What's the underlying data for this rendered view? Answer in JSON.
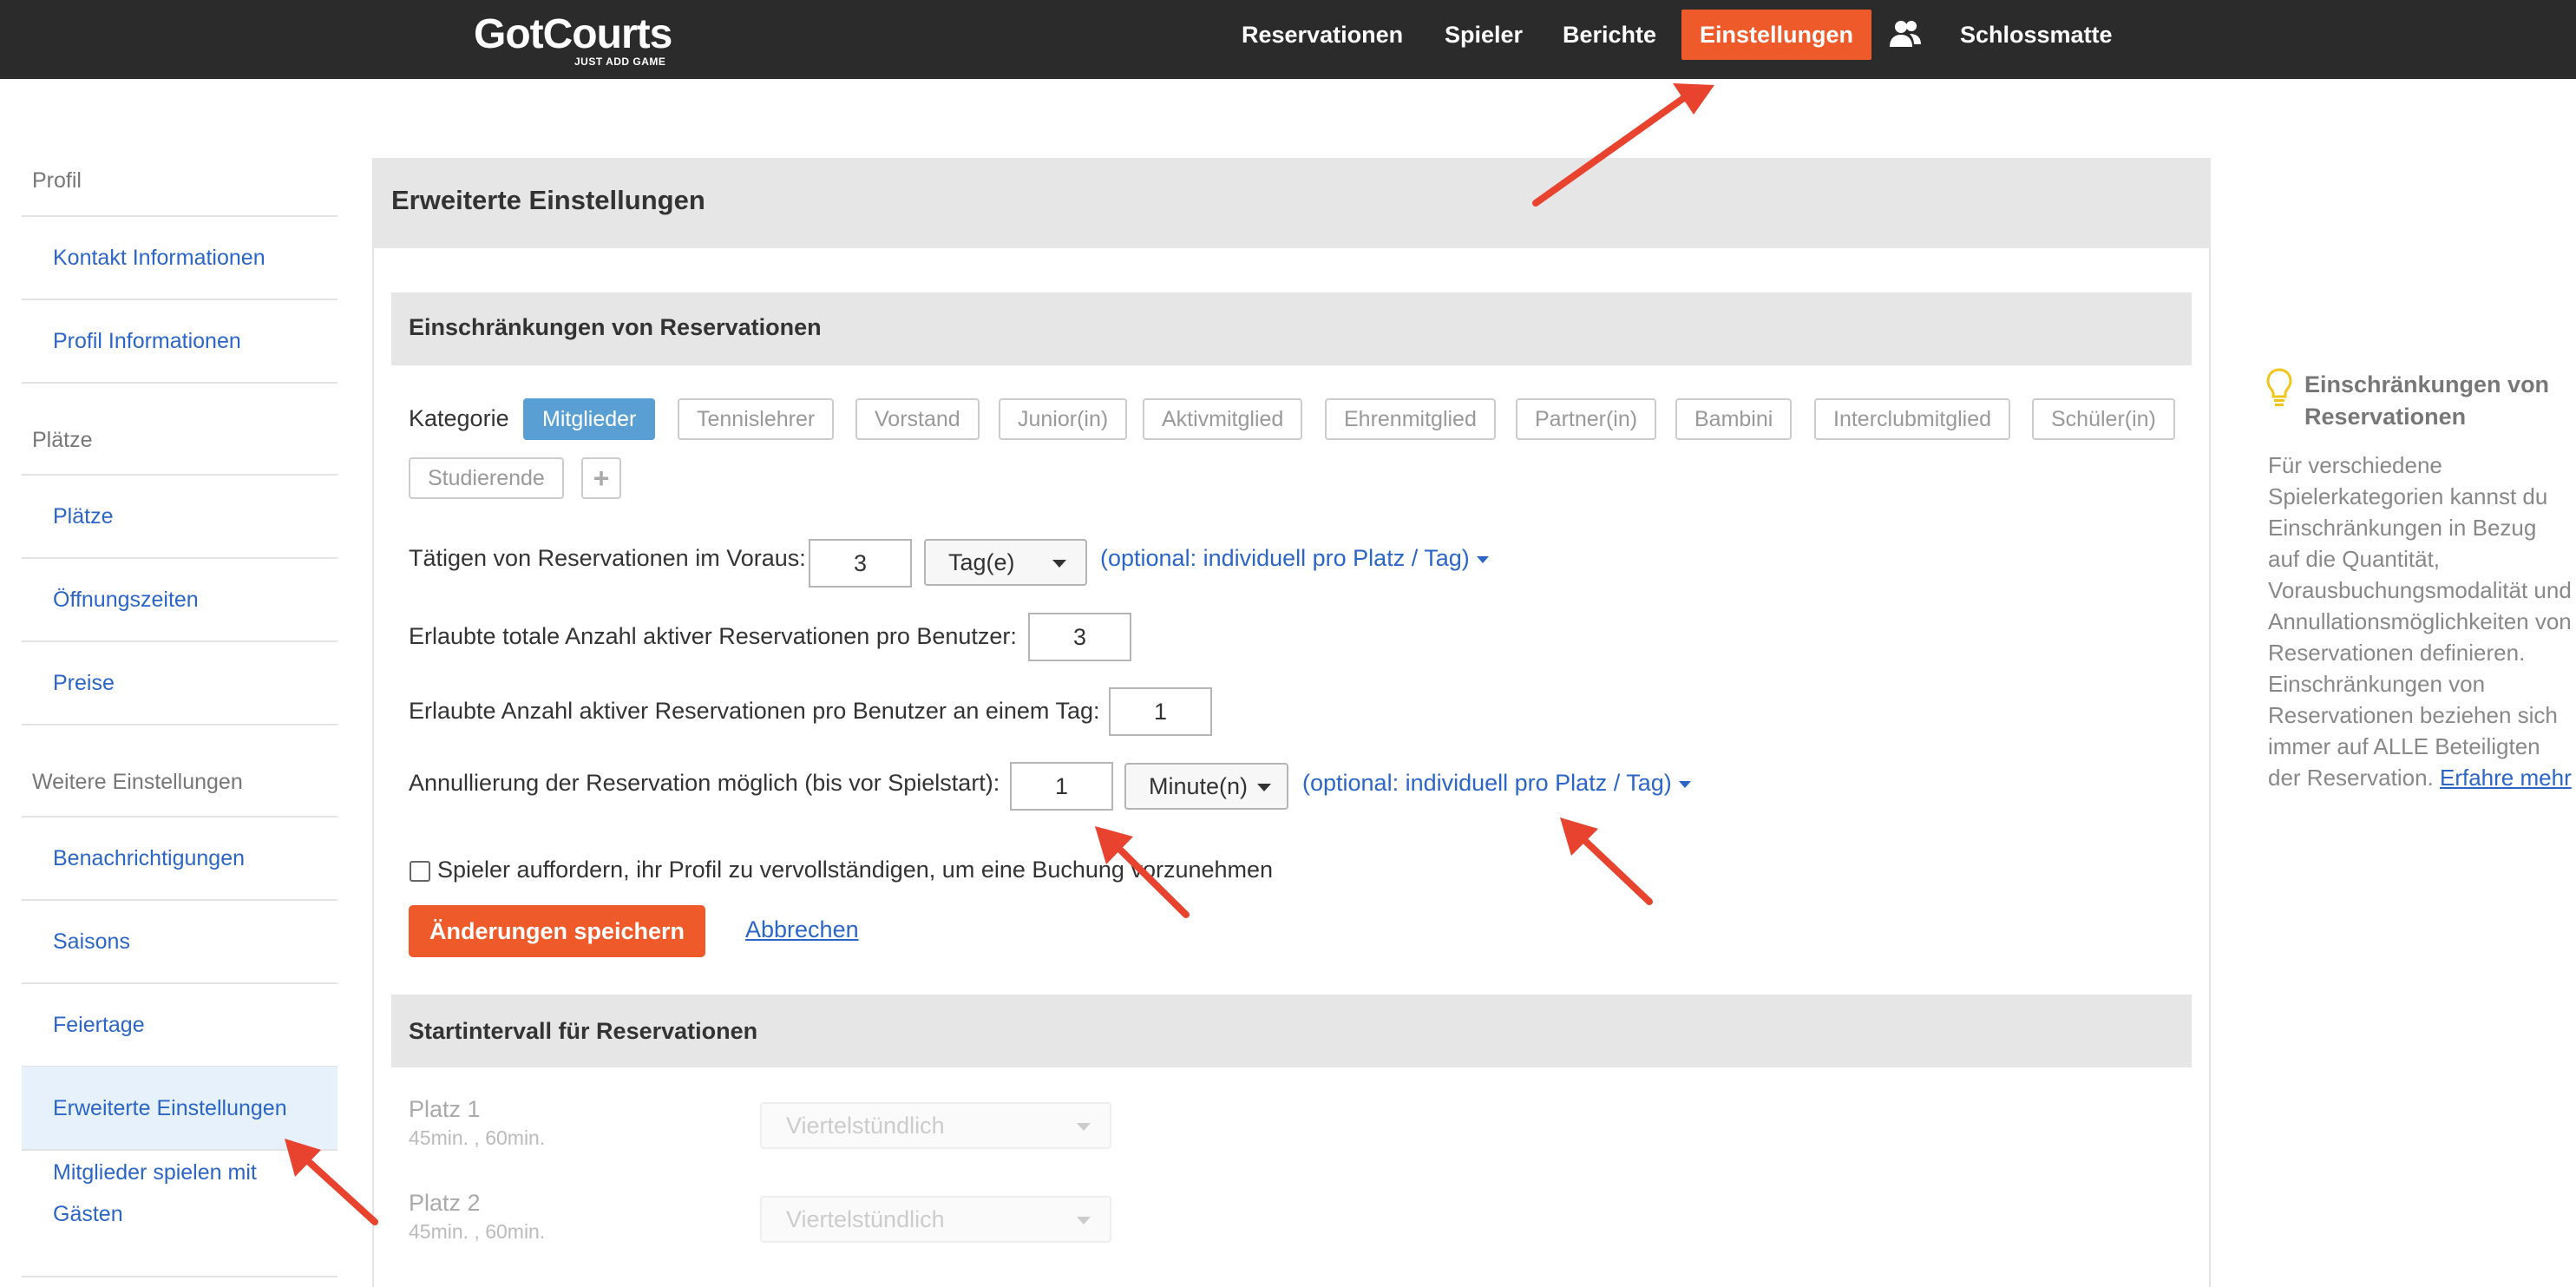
{
  "app": {
    "logo": "GotCourts",
    "logo_tagline": "JUST ADD GAME"
  },
  "nav": {
    "reservations": "Reservationen",
    "players": "Spieler",
    "reports": "Berichte",
    "settings": "Einstellungen",
    "club": "Schlossmatte",
    "user_icon": "users-icon"
  },
  "sidebar": {
    "profile_header": "Profil",
    "contact_info": "Kontakt Informationen",
    "profile_info": "Profil Informationen",
    "courts_header": "Plätze",
    "courts": "Plätze",
    "opening_hours": "Öffnungszeiten",
    "prices": "Preise",
    "more_header": "Weitere Einstellungen",
    "notifications": "Benachrichtigungen",
    "seasons": "Saisons",
    "holidays": "Feiertage",
    "advanced": "Erweiterte Einstellungen",
    "guests_line1": "Mitglieder spielen mit",
    "guests_line2": "Gästen"
  },
  "main": {
    "title": "Erweiterte Einstellungen",
    "restrictions": {
      "title": "Einschränkungen von Reservationen",
      "category_label": "Kategorie",
      "categories": [
        "Mitglieder",
        "Tennislehrer",
        "Vorstand",
        "Junior(in)",
        "Aktivmitglied",
        "Ehrenmitglied",
        "Partner(in)",
        "Bambini",
        "Interclubmitglied",
        "Schüler(in)",
        "Studierende"
      ],
      "add_category_icon": "plus-icon",
      "advance_label": "Tätigen von Reservationen im Voraus:",
      "advance_value": "3",
      "advance_unit": "Tag(e)",
      "advance_optional": "(optional: individuell pro Platz / Tag)",
      "total_label": "Erlaubte totale Anzahl aktiver Reservationen pro Benutzer:",
      "total_value": "3",
      "per_day_label": "Erlaubte Anzahl aktiver Reservationen pro Benutzer an einem Tag:",
      "per_day_value": "1",
      "cancel_label": "Annullierung der Reservation möglich (bis vor Spielstart):",
      "cancel_value": "1",
      "cancel_unit": "Minute(n)",
      "cancel_optional": "(optional: individuell pro Platz / Tag)",
      "profile_checkbox_label": "Spieler auffordern, ihr Profil zu vervollständigen, um eine Buchung vorzunehmen",
      "save_label": "Änderungen speichern",
      "cancel_link": "Abbrechen"
    },
    "start_interval": {
      "title": "Startintervall für Reservationen",
      "courts": [
        {
          "name": "Platz 1",
          "durations": "45min. , 60min.",
          "interval": "Viertelstündlich"
        },
        {
          "name": "Platz 2",
          "durations": "45min. , 60min.",
          "interval": "Viertelstündlich"
        }
      ]
    }
  },
  "info": {
    "icon": "lightbulb-icon",
    "title": "Einschränkungen von Reservationen",
    "body": "Für verschiedene Spielerkategorien kannst du Einschränkungen in Bezug auf die Quantität, Vorausbuchungsmodalität und Annullationsmöglichkeiten von Reservationen definieren. Einschränkungen von Reservationen beziehen sich immer auf ALLE Beteiligten der Reservation.",
    "link": "Erfahre mehr"
  },
  "colors": {
    "topbar": "#2b2b2b",
    "accent": "#ee5a2a",
    "link": "#2b65c7",
    "active_category": "#5a9fd4",
    "annotation_arrow": "#e8432e"
  }
}
